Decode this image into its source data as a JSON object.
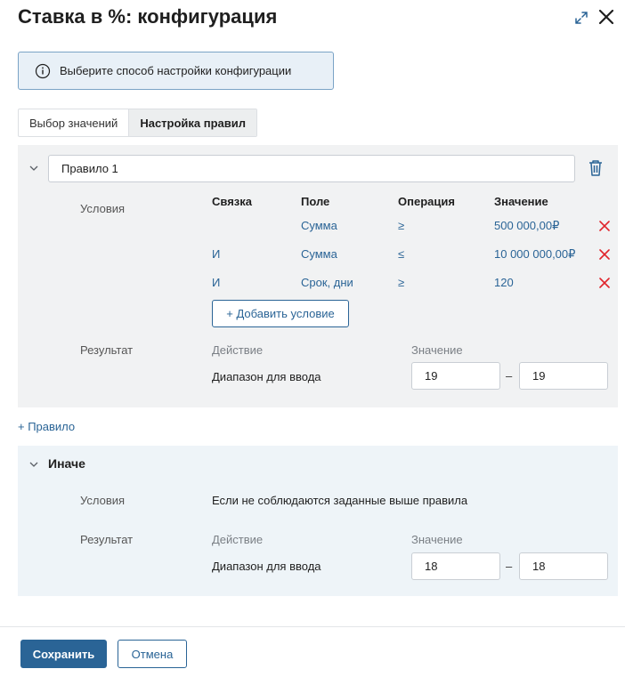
{
  "dialog": {
    "title": "Ставка в %: конфигурация",
    "expand_icon": "expand-icon",
    "close_icon": "close-icon"
  },
  "info_banner": {
    "icon": "info-icon",
    "text": "Выберите способ настройки конфигурации"
  },
  "tabs": [
    {
      "label": "Выбор значений",
      "active": false
    },
    {
      "label": "Настройка правил",
      "active": true
    }
  ],
  "rule": {
    "name": "Правило 1",
    "conditions_label": "Условия",
    "columns": {
      "link": "Связка",
      "field": "Поле",
      "operation": "Операция",
      "value": "Значение"
    },
    "conditions": [
      {
        "link": "",
        "field": "Сумма",
        "operation": "≥",
        "value": "500 000,00₽"
      },
      {
        "link": "И",
        "field": "Сумма",
        "operation": "≤",
        "value": "10 000 000,00₽"
      },
      {
        "link": "И",
        "field": "Срок, дни",
        "operation": "≥",
        "value": "120"
      }
    ],
    "add_condition_label": "+ Добавить условие",
    "result_label": "Результат",
    "action_header": "Действие",
    "value_header": "Значение",
    "action": "Диапазон для ввода",
    "range_from": "19",
    "range_to": "19",
    "range_separator": "–"
  },
  "add_rule_label": "+ Правило",
  "else": {
    "title": "Иначе",
    "conditions_label": "Условия",
    "conditions_text": "Если не соблюдаются заданные выше правила",
    "result_label": "Результат",
    "action_header": "Действие",
    "value_header": "Значение",
    "action": "Диапазон для ввода",
    "range_from": "18",
    "range_to": "18",
    "range_separator": "–"
  },
  "footer": {
    "save_label": "Сохранить",
    "cancel_label": "Отмена"
  },
  "colors": {
    "accent": "#2a6496",
    "remove": "#e0242b",
    "rule_bg": "#f1f2f3",
    "else_bg": "#eef4f8"
  }
}
